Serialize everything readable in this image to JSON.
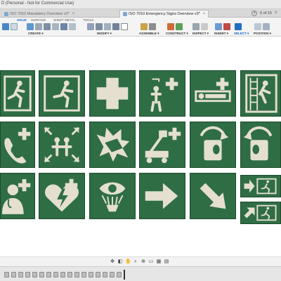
{
  "window": {
    "app_title": "D (Personal - Not for Commercial Use)"
  },
  "tabs": [
    {
      "label": "ISO 7010 Mandatory Overview v3*",
      "active": false
    },
    {
      "label": "ISO 7010 Emergency Signs Overview v3*",
      "active": true
    }
  ],
  "tab_right": {
    "page_info": "6 of 15"
  },
  "workspace_tabs": [
    "SOLID",
    "SURFACE",
    "SHEET METAL",
    "TOOLS"
  ],
  "workspace_active": "SOLID",
  "toolbar_groups": [
    {
      "label": "CREATE ▾"
    },
    {
      "label": "MODIFY ▾"
    },
    {
      "label": "ASSEMBLE ▾"
    },
    {
      "label": "CONSTRUCT ▾"
    },
    {
      "label": "INSPECT ▾"
    },
    {
      "label": "INSERT ▾"
    },
    {
      "label": "SELECT ▾"
    },
    {
      "label": "POSITION ▾"
    }
  ],
  "colors": {
    "sign_green": "#2f6d45",
    "sign_symbol": "#e4dfcf",
    "accent_blue": "#0b66c3"
  },
  "signs": [
    {
      "icon": "emergency-exit-left-icon"
    },
    {
      "icon": "emergency-exit-running-icon"
    },
    {
      "icon": "first-aid-cross-icon"
    },
    {
      "icon": "emergency-shower-icon"
    },
    {
      "icon": "stretcher-icon"
    },
    {
      "icon": "escape-ladder-icon"
    },
    {
      "icon": "emergency-telephone-icon"
    },
    {
      "icon": "assembly-point-icon"
    },
    {
      "icon": "break-glass-icon"
    },
    {
      "icon": "evacuation-chair-lift-icon"
    },
    {
      "icon": "door-rotate-right-icon"
    },
    {
      "icon": "door-rotate-left-icon"
    },
    {
      "icon": "doctor-icon"
    },
    {
      "icon": "defibrillator-icon"
    },
    {
      "icon": "eyewash-icon"
    },
    {
      "icon": "arrow-right-icon"
    },
    {
      "icon": "arrow-down-right-icon"
    },
    {
      "icon": "exit-arrow-small-icon"
    },
    {
      "icon": "exit-arrow-small-2-icon"
    }
  ]
}
